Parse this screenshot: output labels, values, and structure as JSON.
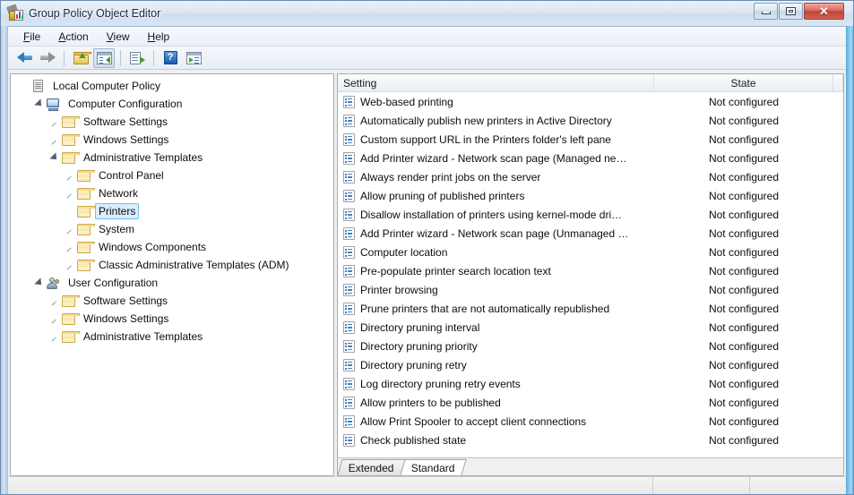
{
  "window": {
    "title": "Group Policy Object Editor",
    "app_icon": "group-policy-icon",
    "buttons": {
      "minimize": "minimize-button",
      "maximize": "restore-button",
      "close": "✕"
    }
  },
  "menubar": {
    "items": [
      {
        "label": "File",
        "accel": "F"
      },
      {
        "label": "Action",
        "accel": "A"
      },
      {
        "label": "View",
        "accel": "V"
      },
      {
        "label": "Help",
        "accel": "H"
      }
    ]
  },
  "toolbar": {
    "items": [
      {
        "name": "back-arrow-icon",
        "title": "Back"
      },
      {
        "name": "forward-arrow-icon",
        "title": "Forward"
      },
      {
        "name": "up-one-level-icon",
        "title": "Up One Level"
      },
      {
        "name": "show-hide-tree-icon",
        "title": "Show/Hide Console Tree"
      },
      {
        "name": "export-list-icon",
        "title": "Export List"
      },
      {
        "name": "help-icon",
        "title": "Help"
      },
      {
        "name": "properties-icon",
        "title": "Properties"
      }
    ],
    "help_glyph": "?"
  },
  "tree": {
    "items": [
      {
        "label": "Local Computer Policy",
        "indent": 0,
        "icon": "policy",
        "expander": "none",
        "selected": false
      },
      {
        "label": "Computer Configuration",
        "indent": 1,
        "icon": "computer",
        "expander": "expanded",
        "selected": false
      },
      {
        "label": "Software Settings",
        "indent": 2,
        "icon": "folder",
        "expander": "collapsed",
        "selected": false
      },
      {
        "label": "Windows Settings",
        "indent": 2,
        "icon": "folder",
        "expander": "collapsed",
        "selected": false
      },
      {
        "label": "Administrative Templates",
        "indent": 2,
        "icon": "folder",
        "expander": "expanded",
        "selected": false
      },
      {
        "label": "Control Panel",
        "indent": 3,
        "icon": "folder",
        "expander": "collapsed",
        "selected": false
      },
      {
        "label": "Network",
        "indent": 3,
        "icon": "folder",
        "expander": "collapsed",
        "selected": false
      },
      {
        "label": "Printers",
        "indent": 3,
        "icon": "folder",
        "expander": "none",
        "selected": true
      },
      {
        "label": "System",
        "indent": 3,
        "icon": "folder",
        "expander": "collapsed",
        "selected": false
      },
      {
        "label": "Windows Components",
        "indent": 3,
        "icon": "folder",
        "expander": "collapsed",
        "selected": false
      },
      {
        "label": "Classic Administrative Templates (ADM)",
        "indent": 3,
        "icon": "folder",
        "expander": "collapsed",
        "selected": false
      },
      {
        "label": "User Configuration",
        "indent": 1,
        "icon": "user",
        "expander": "expanded",
        "selected": false
      },
      {
        "label": "Software Settings",
        "indent": 2,
        "icon": "folder",
        "expander": "collapsed",
        "selected": false
      },
      {
        "label": "Windows Settings",
        "indent": 2,
        "icon": "folder",
        "expander": "collapsed",
        "selected": false
      },
      {
        "label": "Administrative Templates",
        "indent": 2,
        "icon": "folder",
        "expander": "collapsed",
        "selected": false
      }
    ]
  },
  "list": {
    "columns": [
      {
        "label": "Setting",
        "align": "left"
      },
      {
        "label": "State",
        "align": "center"
      },
      {
        "label": "",
        "align": "left"
      }
    ],
    "rows": [
      {
        "setting": "Web-based printing",
        "state": "Not configured"
      },
      {
        "setting": "Automatically publish new printers in Active Directory",
        "state": "Not configured"
      },
      {
        "setting": "Custom support URL in the Printers folder's left pane",
        "state": "Not configured"
      },
      {
        "setting": "Add Printer wizard - Network scan page (Managed ne…",
        "state": "Not configured"
      },
      {
        "setting": "Always render print jobs on the server",
        "state": "Not configured"
      },
      {
        "setting": "Allow pruning of published printers",
        "state": "Not configured"
      },
      {
        "setting": "Disallow installation of printers using kernel-mode dri…",
        "state": "Not configured"
      },
      {
        "setting": "Add Printer wizard - Network scan page (Unmanaged …",
        "state": "Not configured"
      },
      {
        "setting": "Computer location",
        "state": "Not configured"
      },
      {
        "setting": "Pre-populate printer search location text",
        "state": "Not configured"
      },
      {
        "setting": "Printer browsing",
        "state": "Not configured"
      },
      {
        "setting": "Prune printers that are not automatically republished",
        "state": "Not configured"
      },
      {
        "setting": "Directory pruning interval",
        "state": "Not configured"
      },
      {
        "setting": "Directory pruning priority",
        "state": "Not configured"
      },
      {
        "setting": "Directory pruning retry",
        "state": "Not configured"
      },
      {
        "setting": "Log directory pruning retry events",
        "state": "Not configured"
      },
      {
        "setting": "Allow printers to be published",
        "state": "Not configured"
      },
      {
        "setting": "Allow Print Spooler to accept client connections",
        "state": "Not configured"
      },
      {
        "setting": "Check published state",
        "state": "Not configured"
      }
    ]
  },
  "tabs": [
    {
      "label": "Extended",
      "active": false
    },
    {
      "label": "Standard",
      "active": true
    }
  ],
  "statusbar": {
    "text": ""
  },
  "colors": {
    "selection": "#d9eefc",
    "selection_border": "#7bbfe8",
    "frame": "#6a8bb0",
    "close_button": "#bc4436",
    "accent": "#2f7cc0"
  }
}
